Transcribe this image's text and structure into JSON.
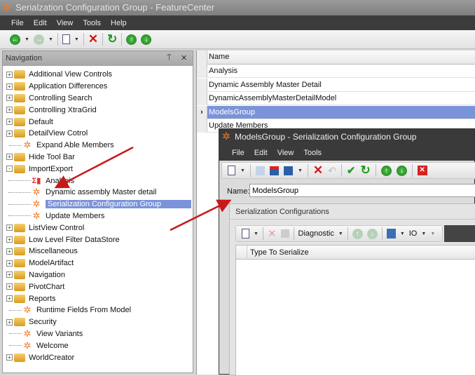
{
  "window": {
    "title": "Serialzation Configuration Group - FeatureCenter"
  },
  "menu": [
    "File",
    "Edit",
    "View",
    "Tools",
    "Help"
  ],
  "navigation": {
    "title": "Navigation",
    "pin": "⍑",
    "close": "✕",
    "items": [
      {
        "label": "Additional View Controls",
        "type": "folder",
        "state": "+"
      },
      {
        "label": "Application Differences",
        "type": "folder",
        "state": "+"
      },
      {
        "label": "Controlling Search",
        "type": "folder",
        "state": "+"
      },
      {
        "label": "Controlling XtraGrid",
        "type": "folder",
        "state": "+"
      },
      {
        "label": "Default",
        "type": "folder",
        "state": "+"
      },
      {
        "label": "DetailView Cotrol",
        "type": "folder",
        "state": "+"
      },
      {
        "label": "Expand Able Members",
        "type": "item"
      },
      {
        "label": "Hide Tool Bar",
        "type": "folder",
        "state": "+"
      },
      {
        "label": "ImportExport",
        "type": "folder",
        "state": "-"
      },
      {
        "label": "Analysis",
        "type": "chart",
        "child": true
      },
      {
        "label": "Dynamic assembly Master detail",
        "type": "item",
        "child": true
      },
      {
        "label": "Serialization Configuration Group",
        "type": "item",
        "child": true,
        "selected": true
      },
      {
        "label": "Update Members",
        "type": "item",
        "child": true
      },
      {
        "label": "ListView Control",
        "type": "folder",
        "state": "+"
      },
      {
        "label": "Low Level Filter DataStore",
        "type": "folder",
        "state": "+"
      },
      {
        "label": "Miscellaneous",
        "type": "folder",
        "state": "+"
      },
      {
        "label": "ModelArtifact",
        "type": "folder",
        "state": "+"
      },
      {
        "label": "Navigation",
        "type": "folder",
        "state": "+"
      },
      {
        "label": "PivotChart",
        "type": "folder",
        "state": "+"
      },
      {
        "label": "Reports",
        "type": "folder",
        "state": "+"
      },
      {
        "label": "Runtime Fields From Model",
        "type": "item"
      },
      {
        "label": "Security",
        "type": "folder",
        "state": "+"
      },
      {
        "label": "View Variants",
        "type": "item"
      },
      {
        "label": "Welcome",
        "type": "item"
      },
      {
        "label": "WorldCreator",
        "type": "folder",
        "state": "+"
      }
    ]
  },
  "grid": {
    "header": "Name",
    "rows": [
      "Analysis",
      "Dynamic Assembly Master Detail",
      "DynamicAssemblyMasterDetailModel",
      "ModelsGroup",
      "Update Members"
    ],
    "selected_index": 3
  },
  "dialog": {
    "title": "ModelsGroup - Serialization Configuration Group",
    "menu": [
      "File",
      "Edit",
      "View",
      "Tools"
    ],
    "name_label": "Name:",
    "name_value": "ModelsGroup",
    "group_title": "Serialization Configurations",
    "inner_toolbar": {
      "diagnostic": "Diagnostic",
      "io": "IO"
    },
    "column": "Type To Serialize"
  },
  "colors": {
    "selection": "#7b93d8",
    "menubar": "#3c3c3c",
    "arrow": "#c81818"
  }
}
